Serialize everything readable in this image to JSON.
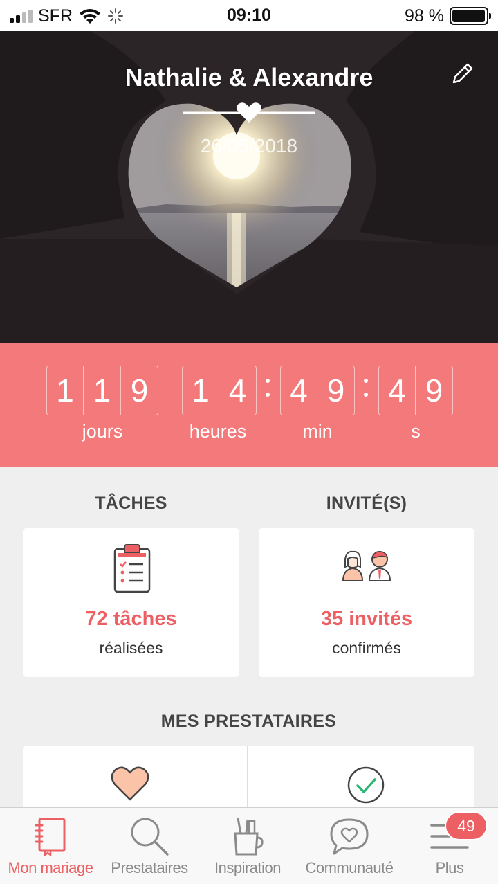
{
  "status_bar": {
    "carrier": "SFR",
    "time": "09:10",
    "battery": "98 %",
    "battery_level": 0.98
  },
  "hero": {
    "couple": "Nathalie & Alexandre",
    "date": "26/05/2018",
    "edit_icon": "pencil-icon"
  },
  "countdown": {
    "days_digits": [
      "1",
      "1",
      "9"
    ],
    "hours_digits": [
      "1",
      "4"
    ],
    "minutes_digits": [
      "4",
      "9"
    ],
    "seconds_digits": [
      "4",
      "9"
    ],
    "labels": {
      "days": "jours",
      "hours": "heures",
      "minutes": "min",
      "seconds": "s"
    },
    "background": "#f4797b"
  },
  "tasks": {
    "title": "TÂCHES",
    "count": "72 tâches",
    "sub": "réalisées",
    "icon": "clipboard-checklist-icon"
  },
  "guests": {
    "title": "INVITÉ(S)",
    "count": "35 invités",
    "sub": "confirmés",
    "icon": "couple-icon"
  },
  "vendors": {
    "title": "MES PRESTATAIRES",
    "items": [
      {
        "icon": "heart-icon"
      },
      {
        "icon": "checkmark-circle-icon"
      }
    ]
  },
  "tabbar": {
    "tabs": [
      {
        "label": "Mon mariage",
        "icon": "notebook-icon",
        "active": true
      },
      {
        "label": "Prestataires",
        "icon": "search-icon",
        "active": false
      },
      {
        "label": "Inspiration",
        "icon": "tools-cup-icon",
        "active": false
      },
      {
        "label": "Communauté",
        "icon": "chat-heart-icon",
        "active": false
      },
      {
        "label": "Plus",
        "icon": "menu-icon",
        "active": false
      }
    ],
    "badge": "49"
  },
  "colors": {
    "accent": "#ec5f63",
    "countdown": "#f4797b",
    "background": "#efefef"
  }
}
